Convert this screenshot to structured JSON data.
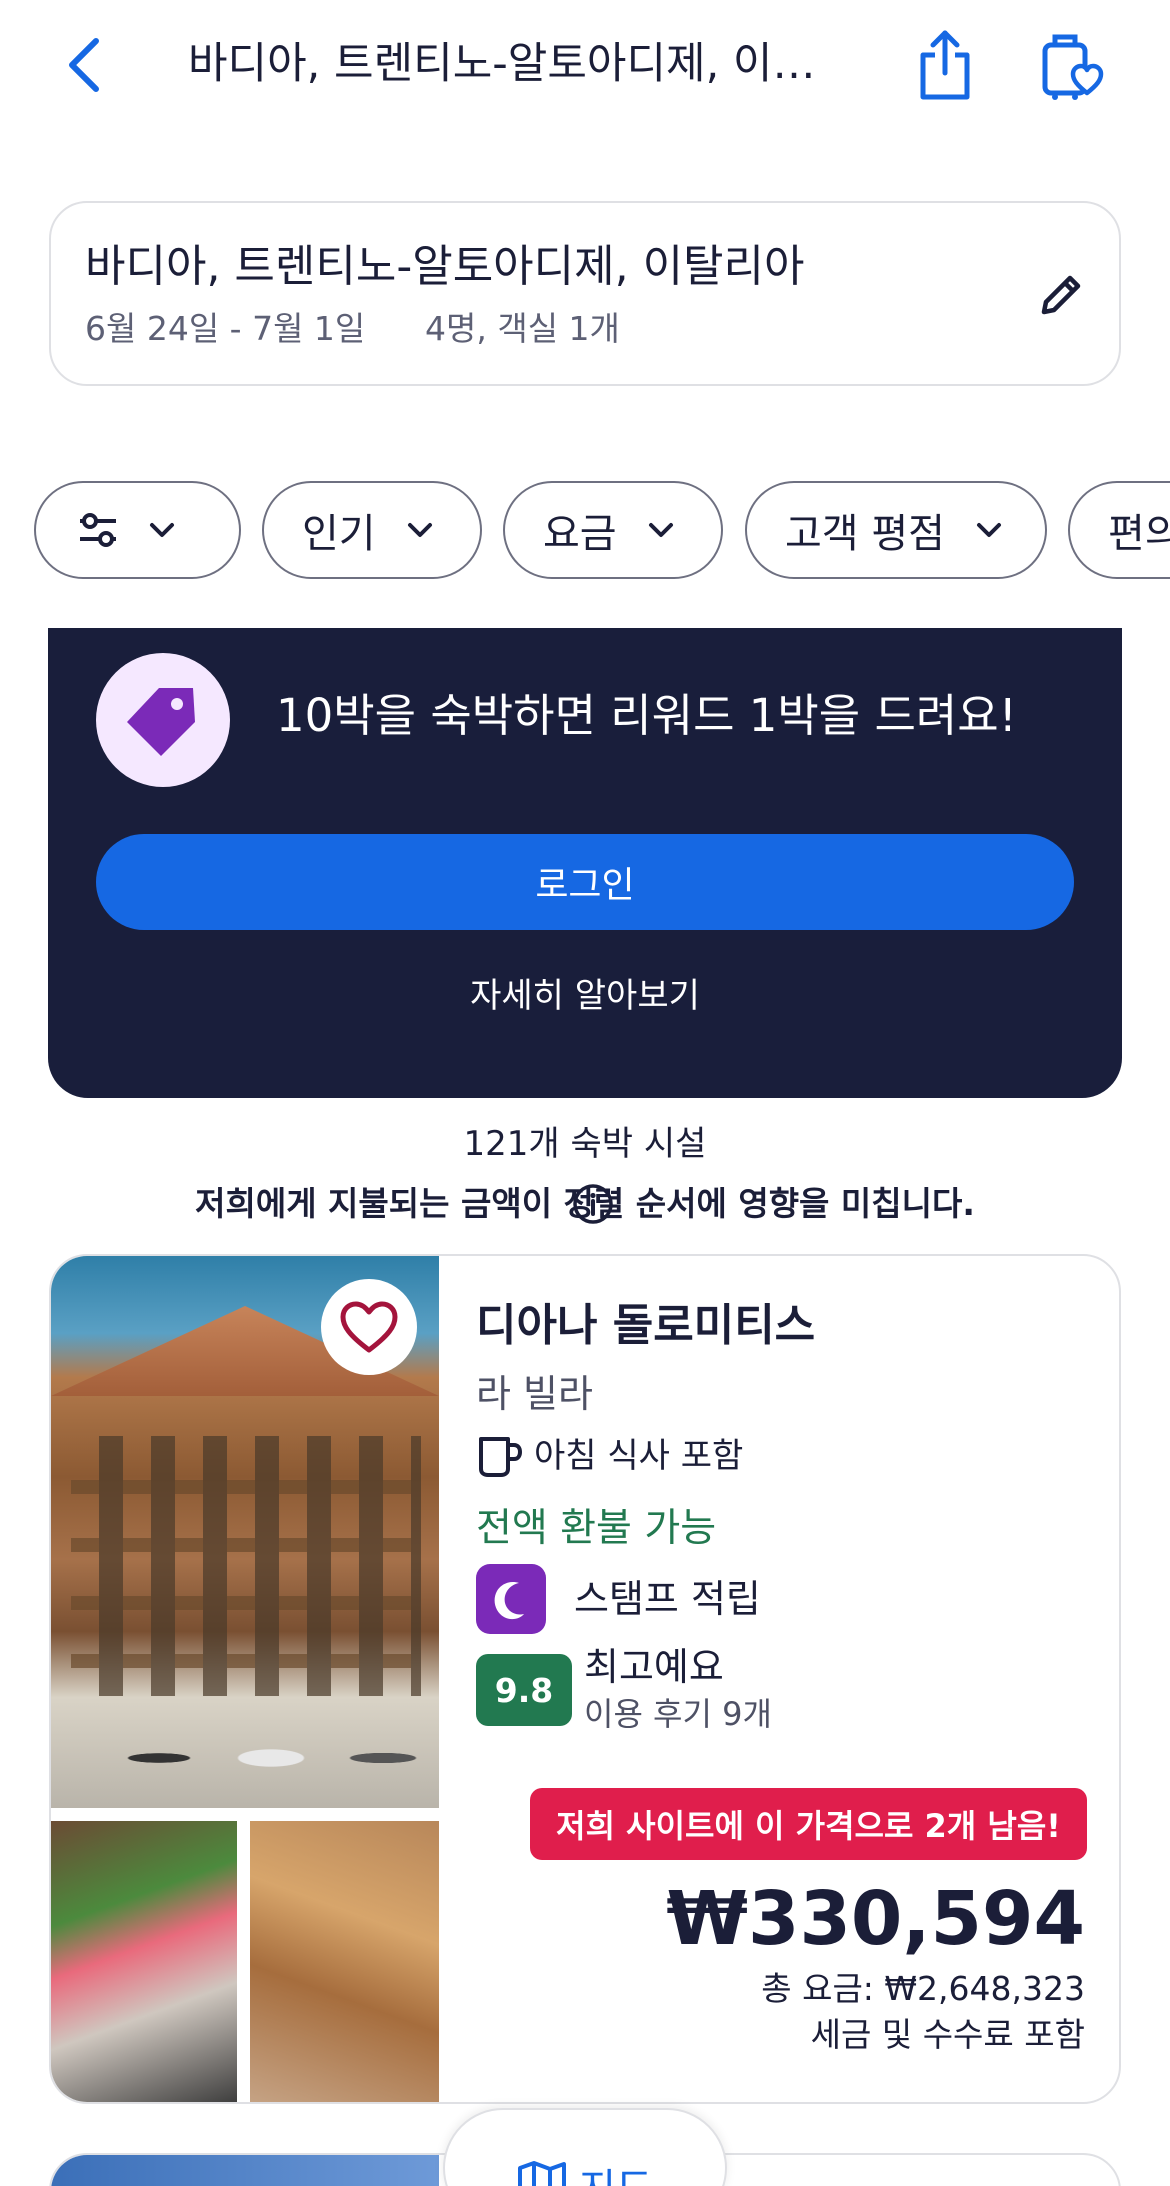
{
  "header": {
    "title": "바디아, 트렌티노-알토아디제, 이…",
    "icons": [
      "back-chevron-icon",
      "share-icon",
      "trips-heart-icon"
    ]
  },
  "search": {
    "destination": "바디아, 트렌티노-알토아디제, 이탈리아",
    "dates": "6월 24일 - 7월 1일",
    "guests": "4명, 객실 1개"
  },
  "filters": {
    "chips": [
      {
        "label": ""
      },
      {
        "label": "인기"
      },
      {
        "label": "요금"
      },
      {
        "label": "고객 평점"
      },
      {
        "label": "편의"
      }
    ]
  },
  "rewards": {
    "message": "10박을 숙박하면 리워드 1박을 드려요!",
    "login_label": "로그인",
    "learn_more_label": "자세히 알아보기",
    "badge_color": "#7b2ab8",
    "background_color": "#191e3b",
    "button_color": "#1668e3"
  },
  "results": {
    "count": "121개 숙박 시설",
    "sort_note": "저희에게 지불되는 금액이 정렬 순서에 영향을 미칩니다."
  },
  "property": {
    "name": "디아나 돌로미티스",
    "area": "라 빌라",
    "breakfast": "아침 식사 포함",
    "refund": "전액 환불 가능",
    "stamp": "스탬프 적립",
    "rating": "9.8",
    "rating_label": "최고예요",
    "reviews": "이용 후기 9개",
    "urgency": "저희 사이트에 이 가격으로 2개 남음!",
    "price": "₩330,594",
    "total": "총 요금: ₩2,648,323",
    "tax_note": "세금 및 수수료 포함",
    "rating_color": "#227950",
    "urgency_color": "#e01e4c"
  },
  "map_button": {
    "label": "지도"
  }
}
